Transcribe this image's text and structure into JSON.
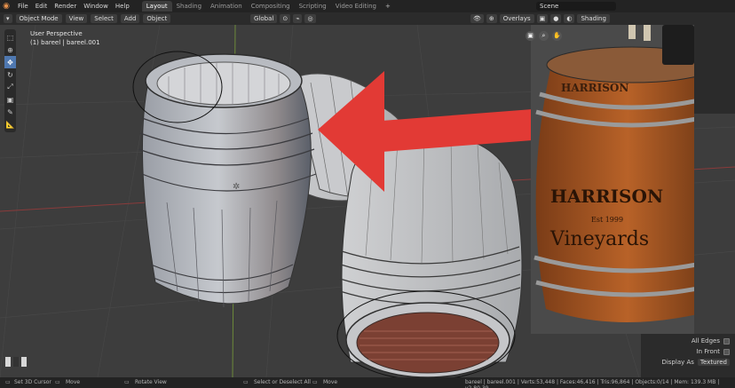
{
  "menubar": {
    "items": [
      "File",
      "Edit",
      "Render",
      "Window",
      "Help"
    ]
  },
  "workspace_tabs": [
    {
      "label": "Layout",
      "active": true
    },
    {
      "label": "Shading",
      "active": false
    },
    {
      "label": "Animation",
      "active": false
    },
    {
      "label": "Compositing",
      "active": false
    },
    {
      "label": "Scripting",
      "active": false
    },
    {
      "label": "Video Editing",
      "active": false
    }
  ],
  "scene_name": "Scene",
  "header": {
    "mode": "Object Mode",
    "view": "View",
    "select": "Select",
    "add": "Add",
    "object": "Object",
    "orientation": "Global",
    "overlays": "Overlays",
    "shading": "Shading"
  },
  "viewport": {
    "perspective": "User Perspective",
    "collection": "(1) bareel | bareel.001"
  },
  "photo": {
    "brand_line1": "HARRISON",
    "brand_est": "Est 1999",
    "brand_line2": "Vineyards"
  },
  "properties": {
    "all_edges": "All Edges",
    "in_front": "In Front",
    "display_as_label": "Display As",
    "display_as_value": "Textured"
  },
  "statusbar": {
    "set_cursor": "Set 3D Cursor",
    "move1": "Move",
    "rotate_view": "Rotate View",
    "select_deselect": "Select or Deselect All",
    "move2": "Move",
    "stats": "bareel | bareel.001 | Verts:53,448 | Faces:46,416 | Tris:96,864 | Objects:0/14 | Mem: 139.3 MB | v2.80.39"
  },
  "colors": {
    "arrow": "#e23a35",
    "active_tool": "#4f78b0",
    "barrel_wood": "#b35a24"
  }
}
